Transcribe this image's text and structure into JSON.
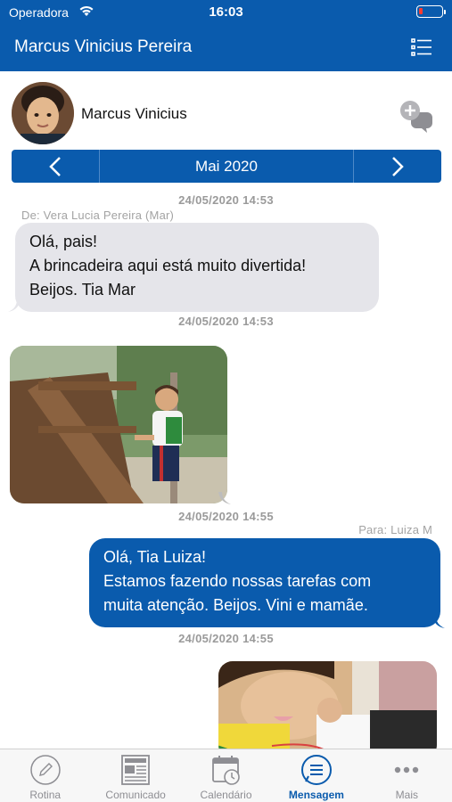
{
  "status_bar": {
    "carrier": "Operadora",
    "time": "16:03"
  },
  "nav": {
    "title": "Marcus Vinicius Pereira",
    "menu_icon": "list-icon"
  },
  "contact": {
    "name": "Marcus Vinicius",
    "new_chat_icon": "add-chat-icon"
  },
  "month_selector": {
    "label": "Mai 2020",
    "prev_icon": "chevron-left-icon",
    "next_icon": "chevron-right-icon"
  },
  "messages": [
    {
      "timestamp": "24/05/2020 14:53",
      "sender": "De: Vera Lucia Pereira (Mar)",
      "direction": "in",
      "type": "text",
      "lines": [
        "Olá, pais!",
        "A brincadeira aqui está muito divertida!",
        "Beijos. Tia Mar"
      ]
    },
    {
      "timestamp": "24/05/2020 14:53",
      "direction": "in",
      "type": "image",
      "image_desc": "playground-photo"
    },
    {
      "timestamp": "24/05/2020 14:55",
      "recipient": "Para: Luiza M",
      "direction": "out",
      "type": "text",
      "lines": [
        "Olá, Tia Luiza!",
        "Estamos fazendo nossas tarefas com",
        "muita atenção. Beijos. Vini e mamãe."
      ]
    },
    {
      "timestamp": "24/05/2020 14:55",
      "direction": "out",
      "type": "image",
      "image_desc": "homework-photo"
    }
  ],
  "tabs": [
    {
      "label": "Rotina",
      "icon": "pencil-circle-icon",
      "active": false
    },
    {
      "label": "Comunicado",
      "icon": "newspaper-icon",
      "active": false
    },
    {
      "label": "Calendário",
      "icon": "calendar-clock-icon",
      "active": false
    },
    {
      "label": "Mensagem",
      "icon": "message-icon",
      "active": true
    },
    {
      "label": "Mais",
      "icon": "more-dots-icon",
      "active": false
    }
  ],
  "colors": {
    "primary": "#0a5bad",
    "bubble_in": "#e5e5ea",
    "timestamp": "#9a9a9a",
    "battery_low": "#ff3b30"
  }
}
